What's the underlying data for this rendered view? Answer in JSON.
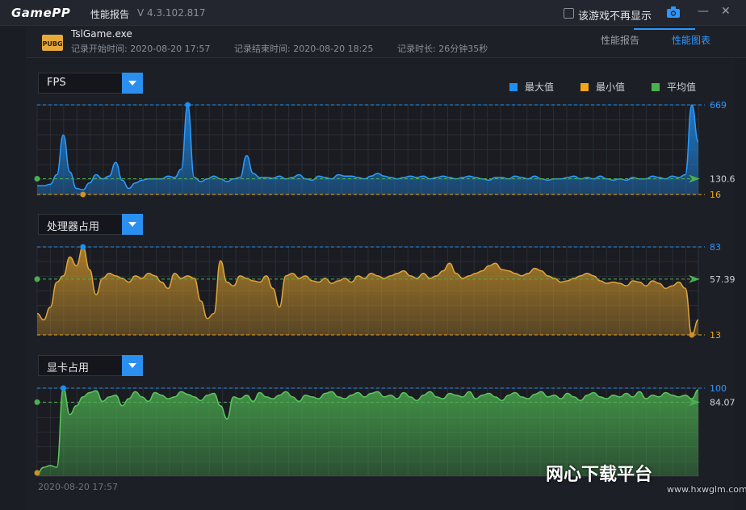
{
  "app": {
    "logo": "GamePP",
    "window_title": "性能报告",
    "version": "V 4.3.102.817",
    "dont_show_label": "该游戏不再显示",
    "minimize": "—",
    "close": "✕"
  },
  "info": {
    "exe": "TslGame.exe",
    "start": "记录开始时间: 2020-08-20 17:57",
    "end": "记录结束时间: 2020-08-20 18:25",
    "duration": "记录时长: 26分钟35秒"
  },
  "tabs": [
    {
      "label": "性能报告",
      "active": false
    },
    {
      "label": "性能图表",
      "active": true
    }
  ],
  "legend": [
    {
      "label": "最大值",
      "color": "#1e8ff0"
    },
    {
      "label": "最小值",
      "color": "#f2a516"
    },
    {
      "label": "平均值",
      "color": "#4caf50"
    }
  ],
  "bottom_timestamp": "2020-08-20 17:57",
  "watermark": "网心下载平台",
  "watermark_url": "www.hxwglm.com",
  "chart_data": [
    {
      "type": "area",
      "selector_label": "FPS",
      "color": "#1e8ff0",
      "max_label": "669",
      "avg_label": "130.6",
      "min_label": "16",
      "max": 669,
      "avg": 130.6,
      "min": 16,
      "values": [
        80,
        80,
        90,
        160,
        450,
        180,
        60,
        50,
        100,
        160,
        130,
        150,
        250,
        120,
        60,
        100,
        120,
        130,
        130,
        130,
        150,
        140,
        200,
        669,
        140,
        110,
        130,
        150,
        130,
        110,
        130,
        140,
        300,
        170,
        140,
        140,
        135,
        150,
        130,
        140,
        160,
        130,
        120,
        150,
        140,
        130,
        160,
        150,
        150,
        140,
        130,
        150,
        170,
        150,
        140,
        130,
        140,
        150,
        140,
        150,
        130,
        140,
        150,
        140,
        130,
        140,
        150,
        140,
        130,
        120,
        140,
        140,
        130,
        150,
        140,
        130,
        150,
        130,
        120,
        130,
        130,
        140,
        150,
        130,
        140,
        130,
        150,
        130,
        120,
        130,
        120,
        140,
        130,
        130,
        150,
        140,
        130,
        150,
        140,
        160,
        669,
        400
      ]
    },
    {
      "type": "area",
      "selector_label": "处理器占用",
      "color": "#c9922a",
      "max_label": "83",
      "avg_label": "57.39",
      "min_label": "13",
      "max": 83,
      "avg": 57.39,
      "min": 13,
      "values": [
        30,
        25,
        35,
        55,
        60,
        75,
        68,
        83,
        65,
        45,
        58,
        62,
        60,
        58,
        55,
        60,
        58,
        62,
        60,
        55,
        50,
        62,
        58,
        60,
        58,
        40,
        26,
        30,
        72,
        55,
        52,
        60,
        58,
        56,
        55,
        60,
        50,
        35,
        60,
        62,
        58,
        60,
        56,
        55,
        58,
        54,
        56,
        58,
        55,
        60,
        58,
        62,
        60,
        58,
        60,
        62,
        64,
        60,
        58,
        62,
        58,
        60,
        64,
        70,
        62,
        58,
        60,
        62,
        64,
        68,
        70,
        65,
        64,
        62,
        60,
        62,
        66,
        64,
        60,
        58,
        55,
        56,
        58,
        60,
        62,
        60,
        56,
        54,
        55,
        54,
        52,
        56,
        55,
        52,
        56,
        54,
        50,
        52,
        55,
        50,
        13,
        25
      ]
    },
    {
      "type": "area",
      "selector_label": "显卡占用",
      "color": "#4caf50",
      "max_label": "100",
      "avg_label": "84.07",
      "min_label": "",
      "max": 100,
      "avg": 84.07,
      "min": 0,
      "values": [
        3,
        10,
        12,
        10,
        100,
        70,
        80,
        90,
        95,
        97,
        85,
        90,
        92,
        80,
        88,
        96,
        90,
        85,
        95,
        92,
        88,
        90,
        96,
        93,
        90,
        86,
        92,
        94,
        80,
        65,
        90,
        88,
        92,
        85,
        95,
        90,
        88,
        92,
        96,
        90,
        85,
        92,
        90,
        88,
        94,
        96,
        90,
        88,
        92,
        95,
        90,
        94,
        96,
        90,
        92,
        88,
        95,
        90,
        86,
        92,
        96,
        90,
        88,
        94,
        92,
        90,
        96,
        88,
        92,
        94,
        90,
        86,
        92,
        95,
        90,
        88,
        93,
        96,
        90,
        92,
        88,
        94,
        90,
        86,
        92,
        95,
        90,
        88,
        92,
        90,
        94,
        90,
        96,
        88,
        92,
        90,
        95,
        92,
        90,
        92,
        88,
        98
      ]
    }
  ]
}
